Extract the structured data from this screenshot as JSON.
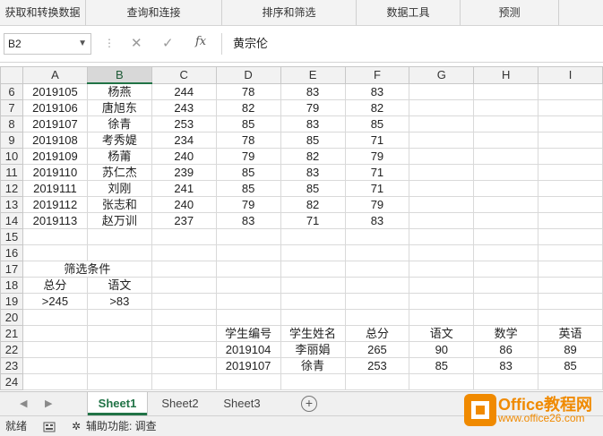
{
  "ribbon": {
    "groups": [
      "获取和转换数据",
      "查询和连接",
      "排序和筛选",
      "数据工具",
      "预测"
    ]
  },
  "formula_bar": {
    "name_box": "B2",
    "value": "黄宗伦",
    "fx_label": "fx",
    "cancel_icon": "close-icon",
    "enter_icon": "checkmark-icon"
  },
  "columns": [
    "A",
    "B",
    "C",
    "D",
    "E",
    "F",
    "G",
    "H",
    "I"
  ],
  "rows": [
    {
      "n": "6",
      "cells": [
        "2019105",
        "杨燕",
        "244",
        "78",
        "83",
        "83",
        "",
        "",
        ""
      ]
    },
    {
      "n": "7",
      "cells": [
        "2019106",
        "唐旭东",
        "243",
        "82",
        "79",
        "82",
        "",
        "",
        ""
      ]
    },
    {
      "n": "8",
      "cells": [
        "2019107",
        "徐青",
        "253",
        "85",
        "83",
        "85",
        "",
        "",
        ""
      ]
    },
    {
      "n": "9",
      "cells": [
        "2019108",
        "考秀媞",
        "234",
        "78",
        "85",
        "71",
        "",
        "",
        ""
      ]
    },
    {
      "n": "10",
      "cells": [
        "2019109",
        "杨莆",
        "240",
        "79",
        "82",
        "79",
        "",
        "",
        ""
      ]
    },
    {
      "n": "11",
      "cells": [
        "2019110",
        "苏仁杰",
        "239",
        "85",
        "83",
        "71",
        "",
        "",
        ""
      ]
    },
    {
      "n": "12",
      "cells": [
        "2019111",
        "刘刚",
        "241",
        "85",
        "85",
        "71",
        "",
        "",
        ""
      ]
    },
    {
      "n": "13",
      "cells": [
        "2019112",
        "张志和",
        "240",
        "79",
        "82",
        "79",
        "",
        "",
        ""
      ]
    },
    {
      "n": "14",
      "cells": [
        "2019113",
        "赵万训",
        "237",
        "83",
        "71",
        "83",
        "",
        "",
        ""
      ]
    },
    {
      "n": "15",
      "cells": [
        "",
        "",
        "",
        "",
        "",
        "",
        "",
        "",
        ""
      ]
    },
    {
      "n": "16",
      "cells": [
        "",
        "",
        "",
        "",
        "",
        "",
        "",
        "",
        ""
      ]
    },
    {
      "n": "17",
      "cells": [
        "",
        "",
        "",
        "",
        "",
        "",
        "",
        "",
        ""
      ]
    },
    {
      "n": "18",
      "cells": [
        "总分",
        "语文",
        "",
        "",
        "",
        "",
        "",
        "",
        ""
      ]
    },
    {
      "n": "19",
      "cells": [
        ">245",
        ">83",
        "",
        "",
        "",
        "",
        "",
        "",
        ""
      ]
    },
    {
      "n": "20",
      "cells": [
        "",
        "",
        "",
        "",
        "",
        "",
        "",
        "",
        ""
      ]
    },
    {
      "n": "21",
      "cells": [
        "",
        "",
        "",
        "学生编号",
        "学生姓名",
        "总分",
        "语文",
        "数学",
        "英语"
      ]
    },
    {
      "n": "22",
      "cells": [
        "",
        "",
        "",
        "2019104",
        "李丽娟",
        "265",
        "90",
        "86",
        "89"
      ]
    },
    {
      "n": "23",
      "cells": [
        "",
        "",
        "",
        "2019107",
        "徐青",
        "253",
        "85",
        "83",
        "85"
      ]
    },
    {
      "n": "24",
      "cells": [
        "",
        "",
        "",
        "",
        "",
        "",
        "",
        "",
        ""
      ]
    }
  ],
  "merged_label_17": "筛选条件",
  "sheets": [
    "Sheet1",
    "Sheet2",
    "Sheet3"
  ],
  "active_sheet": "Sheet1",
  "add_sheet_label": "+",
  "status": {
    "ready": "就绪",
    "accessibility": "辅助功能: 调查"
  },
  "watermark": {
    "brand": "Office教程网",
    "url": "www.office26.com"
  },
  "colors": {
    "excel_green": "#217346",
    "watermark_orange": "#f08a00"
  }
}
